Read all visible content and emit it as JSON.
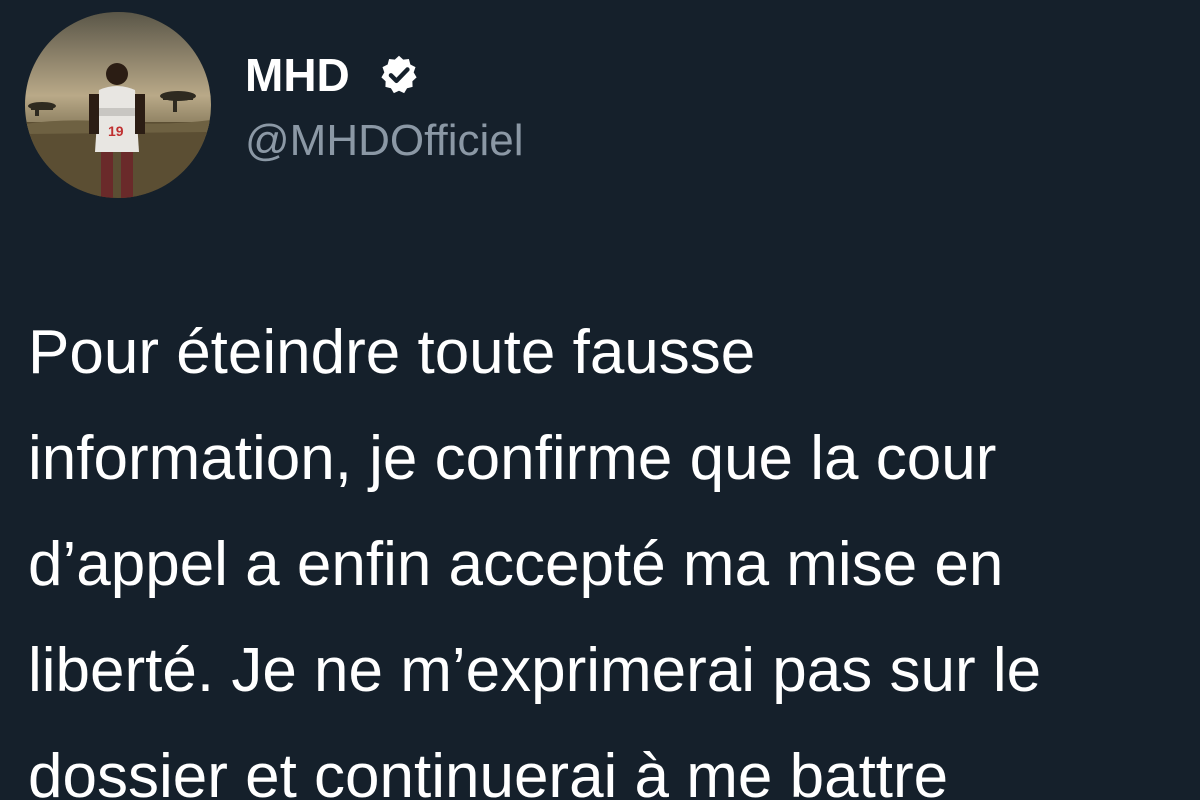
{
  "author": {
    "name": "MHD",
    "handle": "@MHDOfficiel",
    "verified_icon": "verified-badge-icon",
    "avatar_icon": "profile-photo-player-19"
  },
  "tweet": {
    "lines": [
      "Pour éteindre toute fausse",
      "information, je confirme que la cour",
      "d’appel a enfin accepté ma mise en",
      "liberté. Je ne m’exprimerai pas sur le",
      "dossier et continuerai à me battre"
    ]
  },
  "colors": {
    "background": "#15202b",
    "text": "#ffffff",
    "handle": "#8b98a5"
  }
}
